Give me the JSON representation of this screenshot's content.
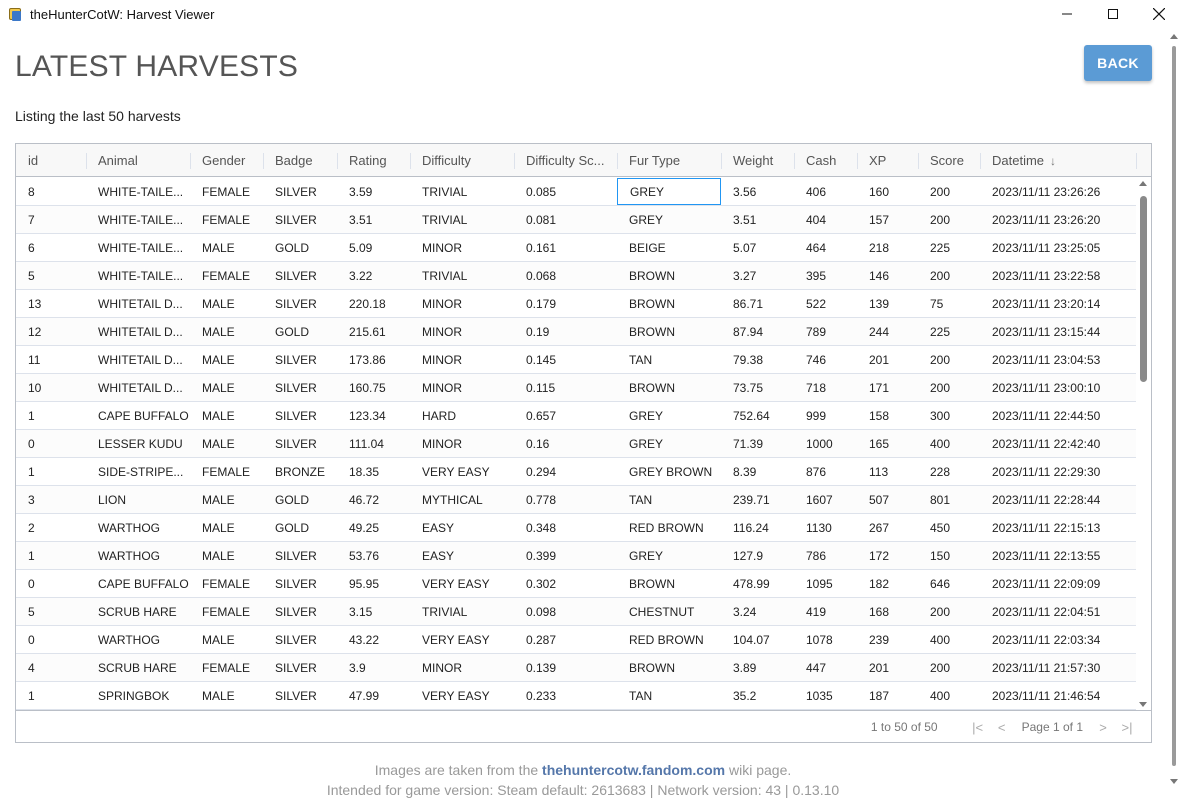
{
  "window": {
    "title": "theHunterCotW: Harvest Viewer",
    "min_label": "—",
    "max_label": "☐",
    "close_label": "✕"
  },
  "header": {
    "title": "LATEST HARVESTS",
    "subtitle": "Listing the last 50 harvests",
    "back_label": "BACK"
  },
  "grid": {
    "columns": [
      {
        "key": "id",
        "label": "id"
      },
      {
        "key": "animal",
        "label": "Animal"
      },
      {
        "key": "gender",
        "label": "Gender"
      },
      {
        "key": "badge",
        "label": "Badge"
      },
      {
        "key": "rating",
        "label": "Rating"
      },
      {
        "key": "difficulty",
        "label": "Difficulty"
      },
      {
        "key": "difficulty_score",
        "label": "Difficulty Sc..."
      },
      {
        "key": "fur_type",
        "label": "Fur Type"
      },
      {
        "key": "weight",
        "label": "Weight"
      },
      {
        "key": "cash",
        "label": "Cash"
      },
      {
        "key": "xp",
        "label": "XP"
      },
      {
        "key": "score",
        "label": "Score"
      },
      {
        "key": "datetime",
        "label": "Datetime",
        "sort": "↓"
      }
    ],
    "rows": [
      [
        "8",
        "WHITE-TAILE...",
        "FEMALE",
        "SILVER",
        "3.59",
        "TRIVIAL",
        "0.085",
        "GREY",
        "3.56",
        "406",
        "160",
        "200",
        "2023/11/11 23:26:26"
      ],
      [
        "7",
        "WHITE-TAILE...",
        "FEMALE",
        "SILVER",
        "3.51",
        "TRIVIAL",
        "0.081",
        "GREY",
        "3.51",
        "404",
        "157",
        "200",
        "2023/11/11 23:26:20"
      ],
      [
        "6",
        "WHITE-TAILE...",
        "MALE",
        "GOLD",
        "5.09",
        "MINOR",
        "0.161",
        "BEIGE",
        "5.07",
        "464",
        "218",
        "225",
        "2023/11/11 23:25:05"
      ],
      [
        "5",
        "WHITE-TAILE...",
        "FEMALE",
        "SILVER",
        "3.22",
        "TRIVIAL",
        "0.068",
        "BROWN",
        "3.27",
        "395",
        "146",
        "200",
        "2023/11/11 23:22:58"
      ],
      [
        "13",
        "WHITETAIL D...",
        "MALE",
        "SILVER",
        "220.18",
        "MINOR",
        "0.179",
        "BROWN",
        "86.71",
        "522",
        "139",
        "75",
        "2023/11/11 23:20:14"
      ],
      [
        "12",
        "WHITETAIL D...",
        "MALE",
        "GOLD",
        "215.61",
        "MINOR",
        "0.19",
        "BROWN",
        "87.94",
        "789",
        "244",
        "225",
        "2023/11/11 23:15:44"
      ],
      [
        "11",
        "WHITETAIL D...",
        "MALE",
        "SILVER",
        "173.86",
        "MINOR",
        "0.145",
        "TAN",
        "79.38",
        "746",
        "201",
        "200",
        "2023/11/11 23:04:53"
      ],
      [
        "10",
        "WHITETAIL D...",
        "MALE",
        "SILVER",
        "160.75",
        "MINOR",
        "0.115",
        "BROWN",
        "73.75",
        "718",
        "171",
        "200",
        "2023/11/11 23:00:10"
      ],
      [
        "1",
        "CAPE BUFFALO",
        "MALE",
        "SILVER",
        "123.34",
        "HARD",
        "0.657",
        "GREY",
        "752.64",
        "999",
        "158",
        "300",
        "2023/11/11 22:44:50"
      ],
      [
        "0",
        "LESSER KUDU",
        "MALE",
        "SILVER",
        "111.04",
        "MINOR",
        "0.16",
        "GREY",
        "71.39",
        "1000",
        "165",
        "400",
        "2023/11/11 22:42:40"
      ],
      [
        "1",
        "SIDE-STRIPE...",
        "FEMALE",
        "BRONZE",
        "18.35",
        "VERY EASY",
        "0.294",
        "GREY BROWN",
        "8.39",
        "876",
        "113",
        "228",
        "2023/11/11 22:29:30"
      ],
      [
        "3",
        "LION",
        "MALE",
        "GOLD",
        "46.72",
        "MYTHICAL",
        "0.778",
        "TAN",
        "239.71",
        "1607",
        "507",
        "801",
        "2023/11/11 22:28:44"
      ],
      [
        "2",
        "WARTHOG",
        "MALE",
        "GOLD",
        "49.25",
        "EASY",
        "0.348",
        "RED BROWN",
        "116.24",
        "1130",
        "267",
        "450",
        "2023/11/11 22:15:13"
      ],
      [
        "1",
        "WARTHOG",
        "MALE",
        "SILVER",
        "53.76",
        "EASY",
        "0.399",
        "GREY",
        "127.9",
        "786",
        "172",
        "150",
        "2023/11/11 22:13:55"
      ],
      [
        "0",
        "CAPE BUFFALO",
        "FEMALE",
        "SILVER",
        "95.95",
        "VERY EASY",
        "0.302",
        "BROWN",
        "478.99",
        "1095",
        "182",
        "646",
        "2023/11/11 22:09:09"
      ],
      [
        "5",
        "SCRUB HARE",
        "FEMALE",
        "SILVER",
        "3.15",
        "TRIVIAL",
        "0.098",
        "CHESTNUT",
        "3.24",
        "419",
        "168",
        "200",
        "2023/11/11 22:04:51"
      ],
      [
        "0",
        "WARTHOG",
        "MALE",
        "SILVER",
        "43.22",
        "VERY EASY",
        "0.287",
        "RED BROWN",
        "104.07",
        "1078",
        "239",
        "400",
        "2023/11/11 22:03:34"
      ],
      [
        "4",
        "SCRUB HARE",
        "FEMALE",
        "SILVER",
        "3.9",
        "MINOR",
        "0.139",
        "BROWN",
        "3.89",
        "447",
        "201",
        "200",
        "2023/11/11 21:57:30"
      ],
      [
        "1",
        "SPRINGBOK",
        "MALE",
        "SILVER",
        "47.99",
        "VERY EASY",
        "0.233",
        "TAN",
        "35.2",
        "1035",
        "187",
        "400",
        "2023/11/11 21:46:54"
      ]
    ],
    "focused_cell": {
      "row": 0,
      "col": 7
    },
    "pagination": {
      "row_summary": "1 to 50 of 50",
      "page_text": "Page 1 of 1"
    }
  },
  "footer": {
    "line1_prefix": "Images are taken from the",
    "line1_link": "thehuntercotw.fandom.com",
    "line1_suffix": "wiki page.",
    "line2": "Intended for game version: Steam default: 2613683 | Network version: 43 | 0.13.10"
  },
  "colors": {
    "accent": "#5b9bd5",
    "link": "#5577aa",
    "focus": "#2196f3"
  }
}
